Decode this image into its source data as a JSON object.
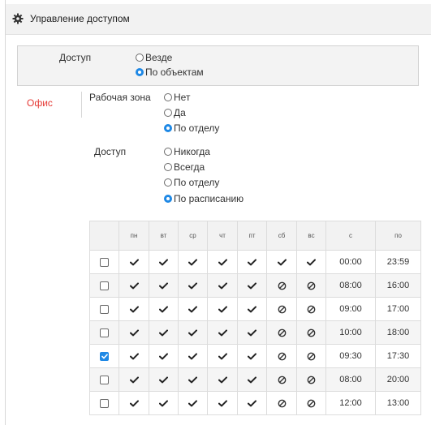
{
  "header": {
    "title": "Управление доступом",
    "icon": "gear-icon"
  },
  "access": {
    "label": "Доступ",
    "options": [
      {
        "label": "Везде",
        "selected": false
      },
      {
        "label": "По объектам",
        "selected": true
      }
    ]
  },
  "office": {
    "name": "Офис",
    "work_zone": {
      "label": "Рабочая зона",
      "options": [
        {
          "label": "Нет",
          "selected": false
        },
        {
          "label": "Да",
          "selected": false
        },
        {
          "label": "По отделу",
          "selected": true
        }
      ]
    },
    "access": {
      "label": "Доступ",
      "options": [
        {
          "label": "Никогда",
          "selected": false
        },
        {
          "label": "Всегда",
          "selected": false
        },
        {
          "label": "По отделу",
          "selected": false
        },
        {
          "label": "По расписанию",
          "selected": true
        }
      ]
    }
  },
  "schedule": {
    "headers": [
      "",
      "пн",
      "вт",
      "ср",
      "чт",
      "пт",
      "сб",
      "вс",
      "с",
      "по"
    ],
    "rows": [
      {
        "checked": false,
        "days": [
          "check",
          "check",
          "check",
          "check",
          "check",
          "check",
          "check"
        ],
        "from": "00:00",
        "to": "23:59"
      },
      {
        "checked": false,
        "days": [
          "check",
          "check",
          "check",
          "check",
          "check",
          "no",
          "no"
        ],
        "from": "08:00",
        "to": "16:00"
      },
      {
        "checked": false,
        "days": [
          "check",
          "check",
          "check",
          "check",
          "check",
          "no",
          "no"
        ],
        "from": "09:00",
        "to": "17:00"
      },
      {
        "checked": false,
        "days": [
          "check",
          "check",
          "check",
          "check",
          "check",
          "no",
          "no"
        ],
        "from": "10:00",
        "to": "18:00"
      },
      {
        "checked": true,
        "days": [
          "check",
          "check",
          "check",
          "check",
          "check",
          "no",
          "no"
        ],
        "from": "09:30",
        "to": "17:30"
      },
      {
        "checked": false,
        "days": [
          "check",
          "check",
          "check",
          "check",
          "check",
          "no",
          "no"
        ],
        "from": "08:00",
        "to": "20:00"
      },
      {
        "checked": false,
        "days": [
          "check",
          "check",
          "check",
          "check",
          "check",
          "no",
          "no"
        ],
        "from": "12:00",
        "to": "13:00"
      }
    ]
  },
  "colors": {
    "accent": "#1e88e5",
    "office_label": "#e53935"
  }
}
